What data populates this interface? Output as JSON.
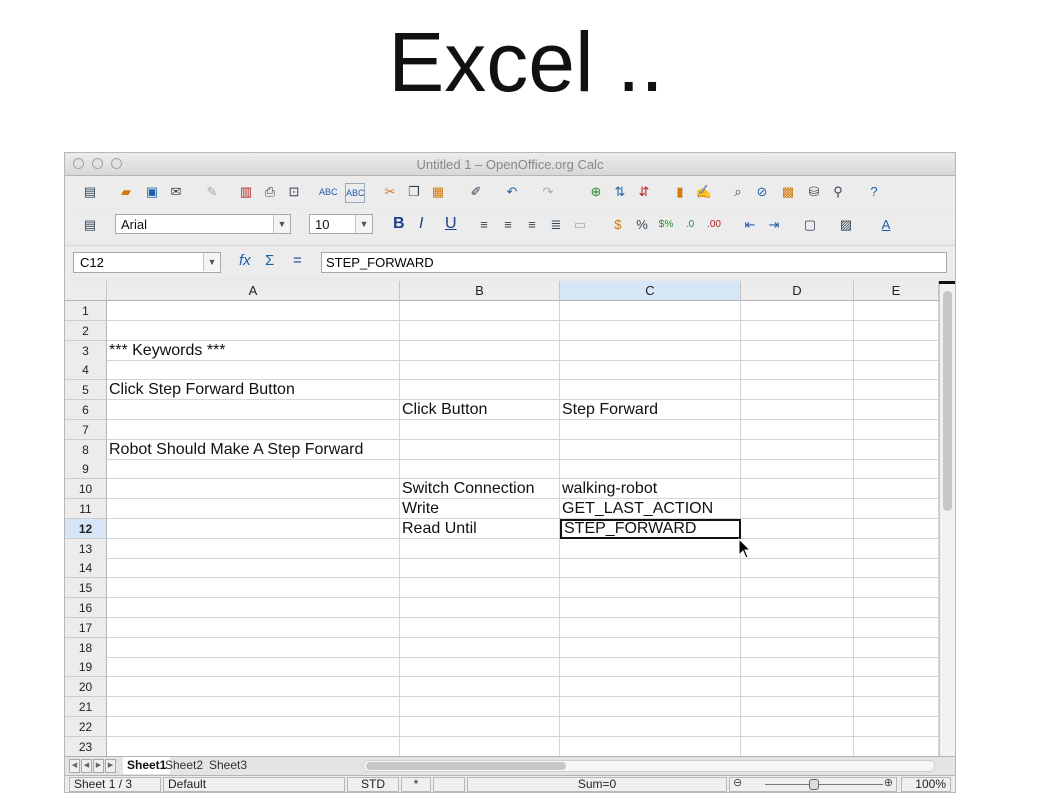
{
  "slide": {
    "title": "Excel .."
  },
  "window": {
    "title": "Untitled 1 – OpenOffice.org Calc"
  },
  "toolbar_top": {
    "icons": [
      "new-icon",
      "open-icon",
      "save-icon",
      "email-icon",
      "edit-file-icon",
      "export-pdf-icon",
      "print-icon",
      "page-preview-icon",
      "spellcheck-icon",
      "autospell-icon",
      "cut-icon",
      "copy-icon",
      "paste-icon",
      "clone-format-icon",
      "undo-icon",
      "redo-icon",
      "hyperlink-icon",
      "sort-ascending-icon",
      "sort-descending-icon",
      "chart-icon",
      "draw-functions-icon",
      "find-replace-icon",
      "navigator-icon",
      "gallery-icon",
      "data-sources-icon",
      "zoom-icon",
      "help-icon"
    ]
  },
  "toolbar_format": {
    "font_name": "Arial",
    "font_size": "10",
    "bold": "B",
    "italic": "I",
    "underline": "U"
  },
  "formula_bar": {
    "cell_ref": "C12",
    "formula": "STEP_FORWARD",
    "equals_symbol": "="
  },
  "columns": [
    "A",
    "B",
    "C",
    "D",
    "E"
  ],
  "selected_column": "C",
  "selected_row": "12",
  "rows": [
    {
      "num": "1",
      "A": "",
      "B": "",
      "C": "",
      "D": "",
      "E": ""
    },
    {
      "num": "2",
      "A": "",
      "B": "",
      "C": "",
      "D": "",
      "E": ""
    },
    {
      "num": "3",
      "A": "*** Keywords ***",
      "B": "",
      "C": "",
      "D": "",
      "E": ""
    },
    {
      "num": "4",
      "A": "",
      "B": "",
      "C": "",
      "D": "",
      "E": ""
    },
    {
      "num": "5",
      "A": "Click Step Forward Button",
      "B": "",
      "C": "",
      "D": "",
      "E": ""
    },
    {
      "num": "6",
      "A": "",
      "B": "Click Button",
      "C": " Step Forward",
      "D": "",
      "E": ""
    },
    {
      "num": "7",
      "A": "",
      "B": "",
      "C": "",
      "D": "",
      "E": ""
    },
    {
      "num": "8",
      "A": "Robot Should Make A Step Forward",
      "B": "",
      "C": "",
      "D": "",
      "E": ""
    },
    {
      "num": "9",
      "A": "",
      "B": "",
      "C": "",
      "D": "",
      "E": ""
    },
    {
      "num": "10",
      "A": "",
      "B": "Switch Connection",
      "C": "walking-robot",
      "D": "",
      "E": ""
    },
    {
      "num": "11",
      "A": "",
      "B": "Write",
      "C": "GET_LAST_ACTION",
      "D": "",
      "E": ""
    },
    {
      "num": "12",
      "A": "",
      "B": "Read Until",
      "C": "STEP_FORWARD",
      "D": "",
      "E": ""
    },
    {
      "num": "13",
      "A": "",
      "B": "",
      "C": "",
      "D": "",
      "E": ""
    },
    {
      "num": "14",
      "A": "",
      "B": "",
      "C": "",
      "D": "",
      "E": ""
    },
    {
      "num": "15",
      "A": "",
      "B": "",
      "C": "",
      "D": "",
      "E": ""
    },
    {
      "num": "16",
      "A": "",
      "B": "",
      "C": "",
      "D": "",
      "E": ""
    },
    {
      "num": "17",
      "A": "",
      "B": "",
      "C": "",
      "D": "",
      "E": ""
    },
    {
      "num": "18",
      "A": "",
      "B": "",
      "C": "",
      "D": "",
      "E": ""
    },
    {
      "num": "19",
      "A": "",
      "B": "",
      "C": "",
      "D": "",
      "E": ""
    },
    {
      "num": "20",
      "A": "",
      "B": "",
      "C": "",
      "D": "",
      "E": ""
    },
    {
      "num": "21",
      "A": "",
      "B": "",
      "C": "",
      "D": "",
      "E": ""
    },
    {
      "num": "22",
      "A": "",
      "B": "",
      "C": "",
      "D": "",
      "E": ""
    },
    {
      "num": "23",
      "A": "",
      "B": "",
      "C": "",
      "D": "",
      "E": ""
    }
  ],
  "sheet_tabs": [
    "Sheet1",
    "Sheet2",
    "Sheet3"
  ],
  "active_sheet": "Sheet1",
  "status_bar": {
    "sheet_pos": "Sheet 1 / 3",
    "page_style": "Default",
    "selection_mode": "STD",
    "modified": "*",
    "sum": "Sum=0",
    "zoom": "100%"
  }
}
